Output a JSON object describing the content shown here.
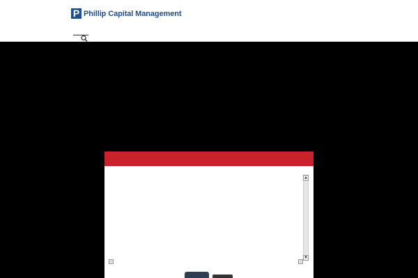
{
  "header": {
    "logo_mark": "P",
    "logo_text": "Phillip Capital Management",
    "brand_color": "#1f4e8c"
  },
  "search": {
    "icon": "search-icon"
  },
  "modal": {
    "header_color": "#c9222b",
    "textarea_value": "",
    "scroll_up_glyph": "▲",
    "scroll_down_glyph": "▼",
    "primary_button_label": "",
    "secondary_button_label": ""
  },
  "overlay_color": "#000000"
}
